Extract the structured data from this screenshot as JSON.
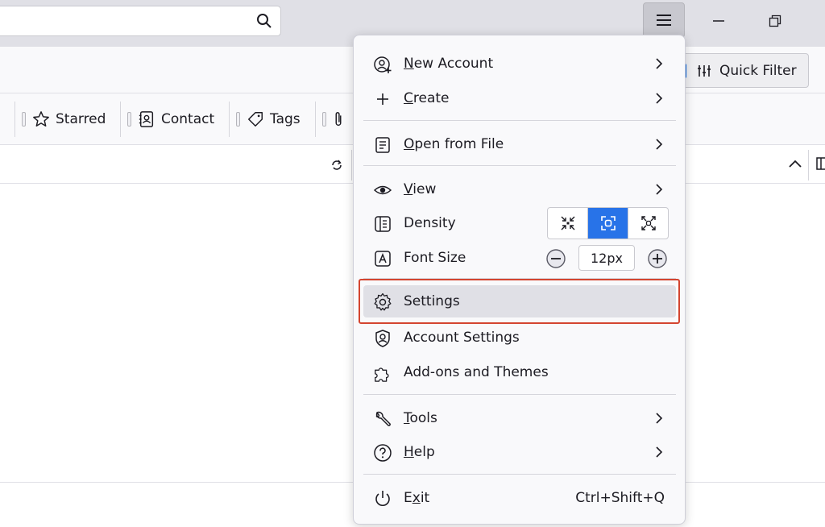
{
  "titlebar": {
    "search_icon": "search-icon",
    "menu_icon": "hamburger-icon",
    "minimize_icon": "minimize-icon",
    "restore_icon": "restore-icon"
  },
  "toolbar": {
    "quick_filter_label": "Quick Filter"
  },
  "filters": {
    "starred": "Starred",
    "contact": "Contact",
    "tags": "Tags"
  },
  "menu": {
    "new_account": {
      "pre": "",
      "u": "N",
      "post": "ew Account"
    },
    "create": {
      "pre": "",
      "u": "C",
      "post": "reate"
    },
    "open_from_file": {
      "pre": "",
      "u": "O",
      "post": "pen from File"
    },
    "view": {
      "pre": "",
      "u": "V",
      "post": "iew"
    },
    "density": "Density",
    "font_size": "Font Size",
    "font_size_value": "12px",
    "settings": "Settings",
    "account_settings": "Account Settings",
    "addons": "Add-ons and Themes",
    "tools": {
      "pre": "",
      "u": "T",
      "post": "ools"
    },
    "help": {
      "pre": "",
      "u": "H",
      "post": "elp"
    },
    "exit": {
      "pre": "E",
      "u": "x",
      "post": "it"
    },
    "exit_shortcut": "Ctrl+Shift+Q",
    "density_selected": "normal"
  },
  "colors": {
    "accent": "#2873e8",
    "highlight_border": "#d44530"
  }
}
